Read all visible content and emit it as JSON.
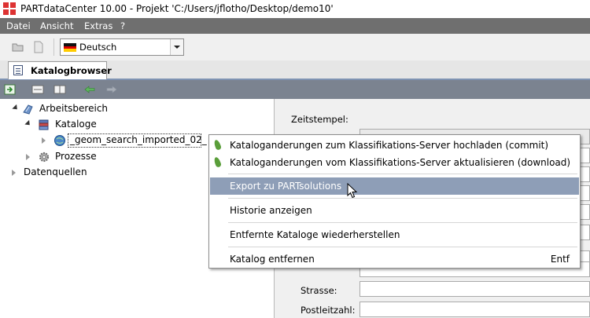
{
  "window": {
    "title": "PARTdataCenter 10.00 - Projekt 'C:/Users/jflotho/Desktop/demo10'"
  },
  "menu": {
    "items": [
      "Datei",
      "Ansicht",
      "Extras",
      "?"
    ]
  },
  "toolbar": {
    "language": "Deutsch"
  },
  "tabs": {
    "active_label": "Katalogbrowser"
  },
  "tree": {
    "items": [
      {
        "label": "Arbeitsbereich",
        "icon": "workspace-icon"
      },
      {
        "label": "Kataloge",
        "icon": "catalogs-stack-icon"
      },
      {
        "label": "_geom_search_imported_02_",
        "icon": "catalog-globe-icon"
      },
      {
        "label": "Prozesse",
        "icon": "gear-icon"
      },
      {
        "label": "Datenquellen",
        "icon": "none"
      }
    ]
  },
  "detail": {
    "timestamp_label": "Zeitstempel:",
    "street_label": "Strasse:",
    "zip_label": "Postleitzahl:"
  },
  "context_menu": {
    "items": [
      {
        "label": "Kataloganderungen zum Klassifikations-Server hochladen (commit)",
        "icon": "leaf-icon"
      },
      {
        "label": "Kataloganderungen vom Klassifikations-Server aktualisieren (download)",
        "icon": "leaf-icon"
      },
      {
        "label": "Export zu PARTsolutions",
        "highlighted": true
      },
      {
        "label": "Historie anzeigen"
      },
      {
        "label": "Entfernte Kataloge wiederherstellen"
      },
      {
        "label": "Katalog entfernen",
        "shortcut": "Entf"
      }
    ]
  },
  "colors": {
    "menubar": "#6f6f6f",
    "highlight": "#8e9eb7",
    "browser_toolbar": "#7b8390"
  }
}
